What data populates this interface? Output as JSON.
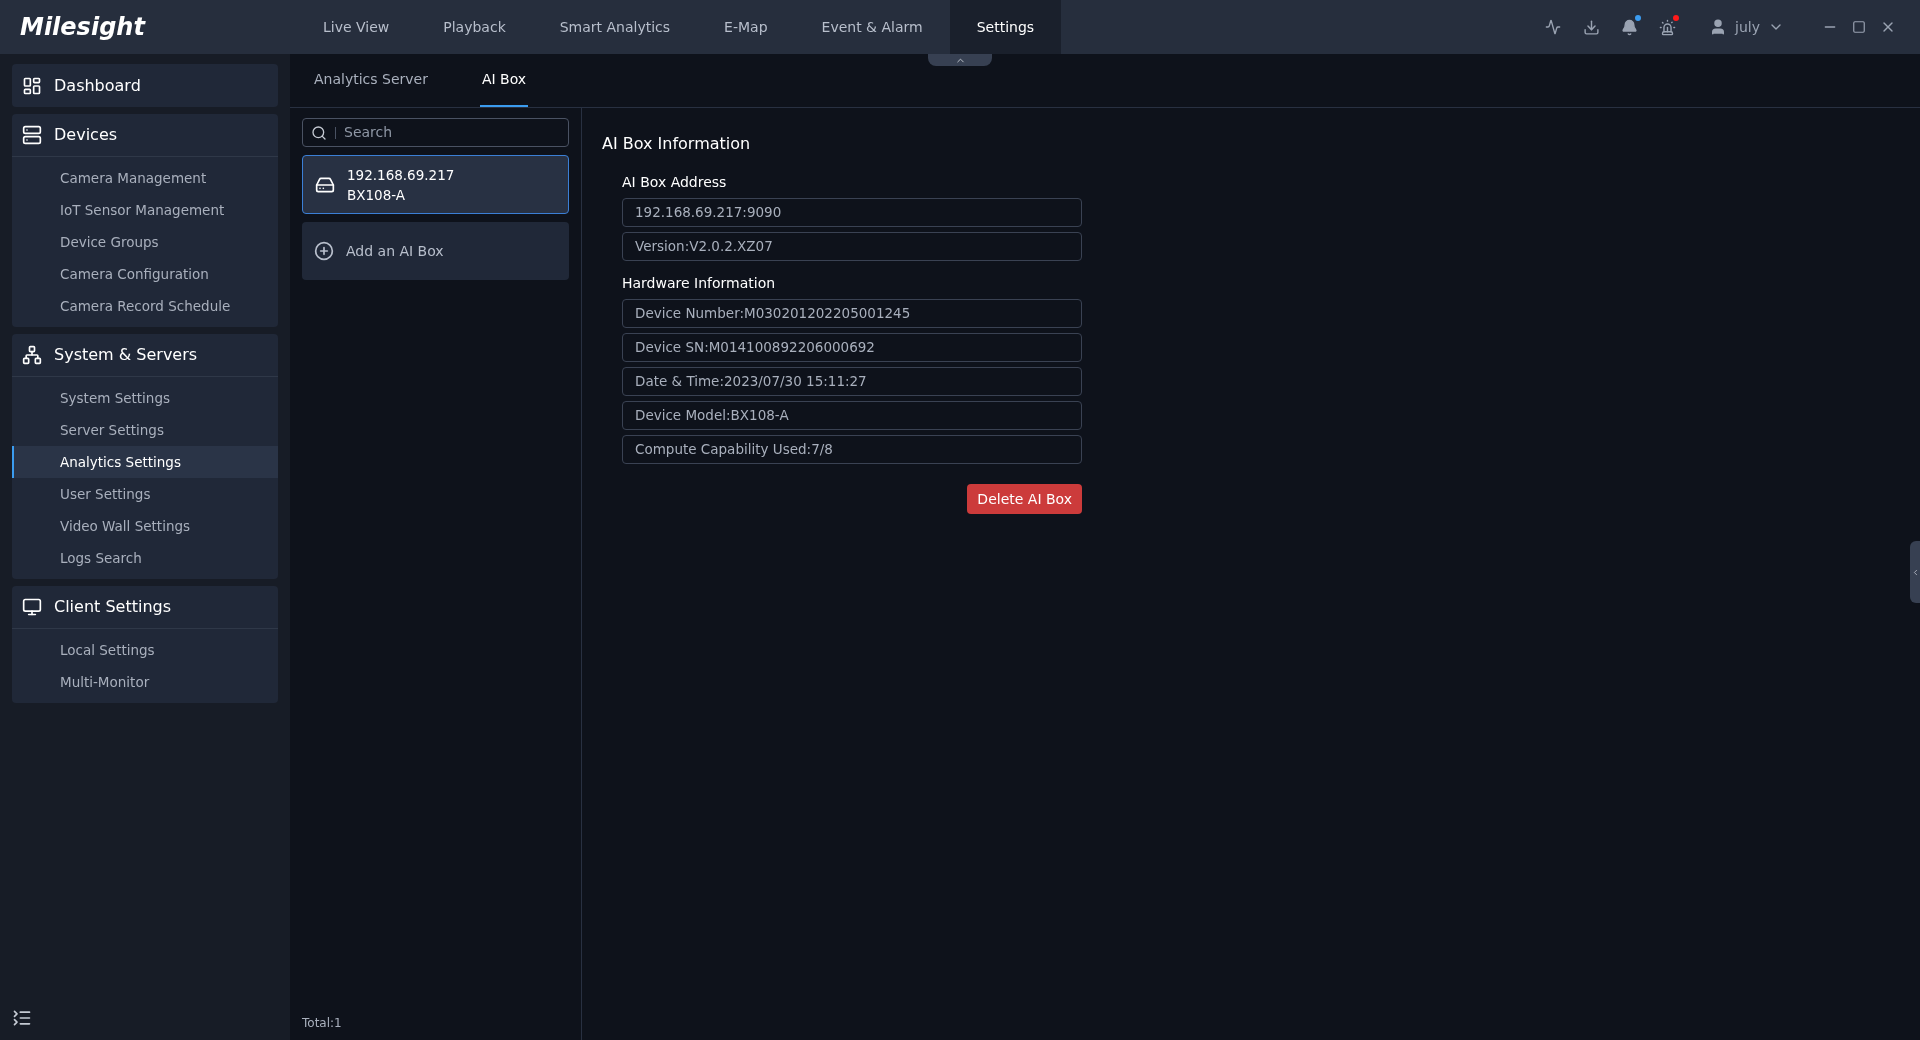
{
  "app": {
    "logo": "Milesight"
  },
  "nav": [
    {
      "label": "Live View",
      "selected": false
    },
    {
      "label": "Playback",
      "selected": false
    },
    {
      "label": "Smart Analytics",
      "selected": false
    },
    {
      "label": "E-Map",
      "selected": false
    },
    {
      "label": "Event & Alarm",
      "selected": false
    },
    {
      "label": "Settings",
      "selected": true
    }
  ],
  "toolbar": [
    {
      "kind": "monitor"
    },
    {
      "kind": "download"
    },
    {
      "kind": "bell",
      "color": "#3b9cf0"
    },
    {
      "kind": "alarm",
      "color": "#ff1a1a"
    }
  ],
  "user": {
    "name": "july"
  },
  "sidebar": [
    {
      "kind": "dashboard",
      "title": "Dashboard"
    },
    {
      "kind": "devices",
      "title": "Devices",
      "items": [
        {
          "label": "Camera Management",
          "selected": false
        },
        {
          "label": "IoT Sensor Management",
          "selected": false
        },
        {
          "label": "Device Groups",
          "selected": false
        },
        {
          "label": "Camera Configuration",
          "selected": false
        },
        {
          "label": "Camera Record Schedule",
          "selected": false
        }
      ]
    },
    {
      "kind": "system",
      "title": "System & Servers",
      "items": [
        {
          "label": "System Settings",
          "selected": false
        },
        {
          "label": "Server Settings",
          "selected": false
        },
        {
          "label": "Analytics Settings",
          "selected": true
        },
        {
          "label": "User Settings",
          "selected": false
        },
        {
          "label": "Video Wall Settings",
          "selected": false
        },
        {
          "label": "Logs Search",
          "selected": false
        }
      ]
    },
    {
      "kind": "client",
      "title": "Client Settings",
      "items": [
        {
          "label": "Local Settings",
          "selected": false
        },
        {
          "label": "Multi-Monitor",
          "selected": false
        }
      ]
    }
  ],
  "tabs": [
    {
      "label": "Analytics Server",
      "selected": false
    },
    {
      "label": "AI Box",
      "selected": true
    }
  ],
  "search": {
    "placeholder": "Search"
  },
  "boxes": [
    {
      "address": "192.168.69.217",
      "model": "BX108-A",
      "selected": true
    }
  ],
  "add_button": "Add an AI Box",
  "total": "Total:1",
  "detail": {
    "title": "AI Box Information",
    "sections": [
      {
        "heading": "AI Box Address",
        "fields": [
          "192.168.69.217:9090",
          "Version:V2.0.2.XZ07"
        ]
      },
      {
        "heading": "Hardware Information",
        "fields": [
          "Device Number:M030201202205001245",
          "Device SN:M014100892206000692",
          "Date & Time:2023/07/30 15:11:27",
          "Device Model:BX108-A",
          "Compute Capability Used:7/8"
        ]
      }
    ],
    "delete_button": "Delete AI Box"
  }
}
